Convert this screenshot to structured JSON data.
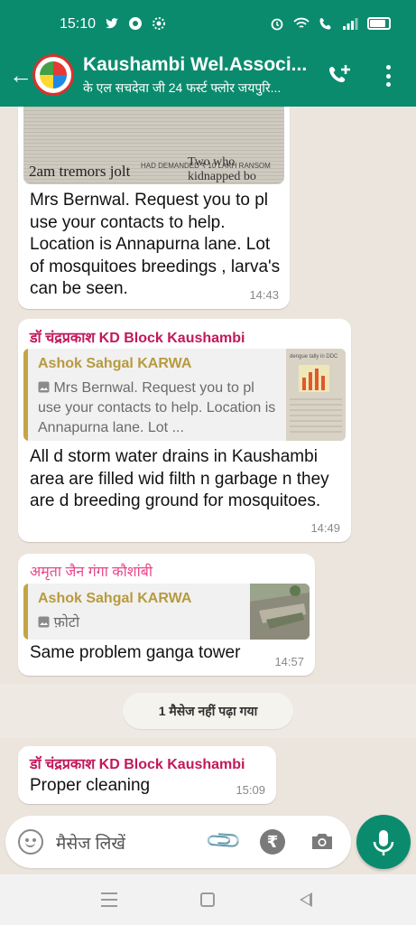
{
  "status_bar": {
    "time": "15:10",
    "left_icons": [
      "twitter-icon",
      "chrome-icon",
      "settings-icon"
    ],
    "right_icons": [
      "alarm-icon",
      "wifi-icon",
      "wifi-calling-icon",
      "signal-icon",
      "battery-icon"
    ],
    "battery_level": 0.85
  },
  "header": {
    "title": "Kaushambi Wel.Associ...",
    "subtitle": "के एल सचदेवा जी 24 फर्स्ट फ्लोर जयपुरि...",
    "colors": {
      "primary": "#0b8b6e"
    }
  },
  "messages": [
    {
      "image_caption_partial": "2am tremors jolt",
      "image_tagline": "HAD DEMANDED ₹ 10 LAKH RANSOM",
      "image_headline_partial": "Two who kidnapped bo",
      "text": "Mrs Bernwal. Request you to pl use your contacts to help. Location is Annapurna lane. Lot of mosquitoes breedings , larva's can be seen.",
      "time": "14:43"
    },
    {
      "sender": "डॉ चंद्रप्रकाश KD Block Kaushambi",
      "sender_color": "#c2185b",
      "quote_author": "Ashok Sahgal KARWA",
      "quote_text": "Mrs Bernwal. Request you to pl use your contacts to help. Location is Annapurna lane. Lot ...",
      "quote_thumb_text": "dengue tally in DDC",
      "text": "All d storm water drains in Kaushambi area are filled wid filth n garbage n they are d breeding ground for mosquitoes.",
      "time": "14:49"
    },
    {
      "sender": "अमृता जैन गंगा कौशांबी",
      "sender_color": "#e8488a",
      "quote_author": "Ashok Sahgal KARWA",
      "quote_text": "फ़ोटो",
      "text": "Same problem ganga tower",
      "time": "14:57"
    },
    {
      "sender": "डॉ चंद्रप्रकाश KD Block Kaushambi",
      "sender_color": "#c2185b",
      "text": "Proper cleaning",
      "time": "15:09"
    }
  ],
  "unread_banner": "1 मैसेज नहीं पढ़ा गया",
  "composer": {
    "placeholder": "मैसेज लिखें",
    "icons": [
      "emoji-icon",
      "attach-icon",
      "rupee-icon",
      "camera-icon",
      "mic-icon"
    ]
  },
  "nav": [
    "menu-icon",
    "home-icon",
    "back-icon"
  ]
}
